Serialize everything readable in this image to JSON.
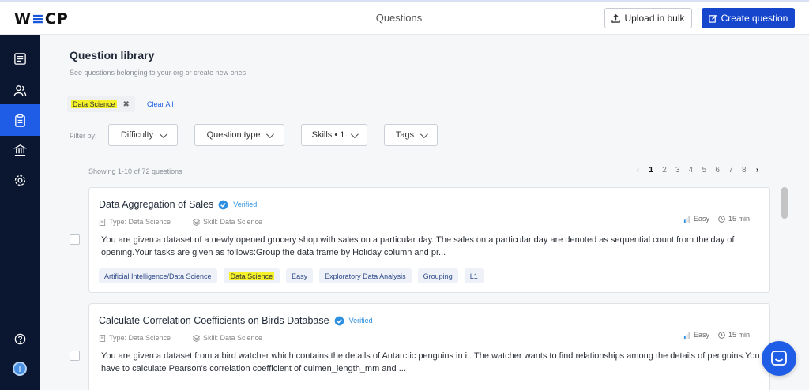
{
  "header": {
    "logo_left": "W",
    "logo_mid": "≡",
    "logo_right": "CP",
    "page_title": "Questions",
    "upload_label": "Upload in bulk",
    "create_label": "Create question"
  },
  "sidebar": {
    "items": [
      {
        "icon": "tests-icon"
      },
      {
        "icon": "users-icon"
      },
      {
        "icon": "clipboard-icon",
        "active": true
      },
      {
        "icon": "bank-icon"
      },
      {
        "icon": "settings-icon"
      }
    ],
    "help_icon": "help-icon",
    "avatar_text": "I"
  },
  "library": {
    "title": "Question library",
    "subtitle": "See questions belonging to your org or create new ones",
    "active_filter": "Data Science",
    "clear_all": "Clear All",
    "filter_by": "Filter by:",
    "filters": [
      "Difficulty",
      "Question type",
      "Skills • 1",
      "Tags"
    ],
    "showing": "Showing 1-10 of 72 questions",
    "pages": [
      "1",
      "2",
      "3",
      "4",
      "5",
      "6",
      "7",
      "8"
    ],
    "current_page": "1"
  },
  "questions": [
    {
      "title": "Data Aggregation of Sales",
      "verified": "Verified",
      "type": "Type: Data Science",
      "skill": "Skill: Data Science",
      "difficulty": "Easy",
      "duration": "15 min",
      "description": "You are given a dataset of a newly opened grocery shop with sales on a particular day. The sales on a particular day are denoted as sequential count from the day of opening.Your tasks are given as follows:Group the data frame by Holiday column and pr...",
      "tags": [
        "Artificial Intelligence/Data Science",
        "Data Science",
        "Easy",
        "Exploratory Data Analysis",
        "Grouping",
        "L1"
      ]
    },
    {
      "title": "Calculate Correlation Coefficients on Birds Database",
      "verified": "Verified",
      "type": "Type: Data Science",
      "skill": "Skill: Data Science",
      "difficulty": "Easy",
      "duration": "15 min",
      "description": "You are given a dataset from a bird watcher which contains the details of Antarctic penguins in it. The watcher wants to find relationships among the details of penguins.You have to calculate Pearson's correlation coefficient of culmen_length_mm and ..."
    }
  ],
  "colors": {
    "primary": "#1646cc",
    "sidebar_bg": "#0b1730",
    "sidebar_active": "#1f5de6",
    "highlight": "#f4f12a",
    "verified": "#2d8fe0"
  }
}
